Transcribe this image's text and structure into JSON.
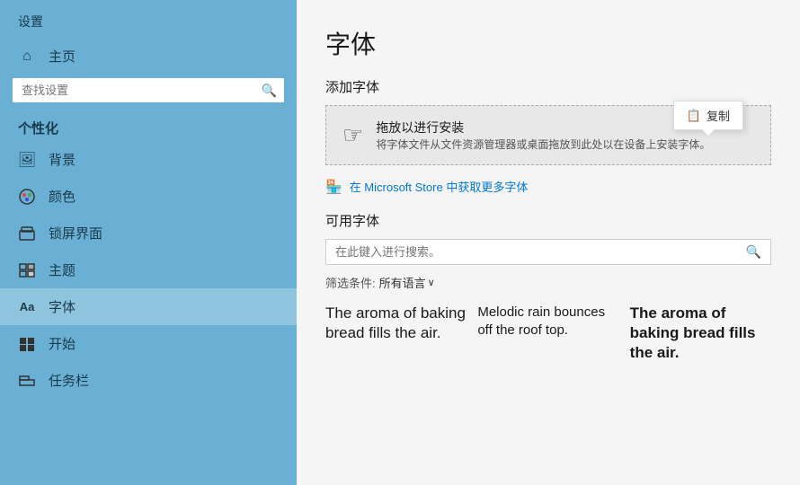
{
  "sidebar": {
    "title": "设置",
    "search_placeholder": "查找设置",
    "section_label": "个性化",
    "nav_items": [
      {
        "id": "home",
        "icon": "⌂",
        "label": "主页"
      },
      {
        "id": "background",
        "icon": "🖼",
        "label": "背景"
      },
      {
        "id": "colors",
        "icon": "☯",
        "label": "颜色"
      },
      {
        "id": "lockscreen",
        "icon": "⬜",
        "label": "锁屏界面"
      },
      {
        "id": "themes",
        "icon": "✎",
        "label": "主题"
      },
      {
        "id": "fonts",
        "icon": "Aa",
        "label": "字体",
        "active": true
      },
      {
        "id": "start",
        "icon": "⊞",
        "label": "开始"
      },
      {
        "id": "taskbar",
        "icon": "▭",
        "label": "任务栏"
      }
    ]
  },
  "main": {
    "page_title": "字体",
    "add_fonts_section": "添加字体",
    "drag_drop": {
      "main_text": "拖放以进行安装",
      "sub_text": "将字体文件从文件资源管理器或桌面拖放到此处以在设备上安装字体。"
    },
    "copy_tooltip_label": "复制",
    "store_link_text": "在 Microsoft Store 中获取更多字体",
    "available_fonts_section": "可用字体",
    "font_search_placeholder": "在此键入进行搜索。",
    "filter": {
      "label": "筛选条件:",
      "value": "所有语言",
      "has_dropdown": true
    },
    "font_previews": [
      {
        "text": "The aroma of baking bread fills the air.",
        "style": "normal"
      },
      {
        "text": "Melodic rain bounces off the roof top.",
        "style": "normal"
      },
      {
        "text": "The aroma of baking bread fills the air.",
        "style": "bold"
      }
    ]
  },
  "icons": {
    "search": "🔍",
    "home": "⌂",
    "copy": "📋",
    "store": "🏪",
    "drag_cursor": "☞",
    "chevron_down": "∨"
  }
}
